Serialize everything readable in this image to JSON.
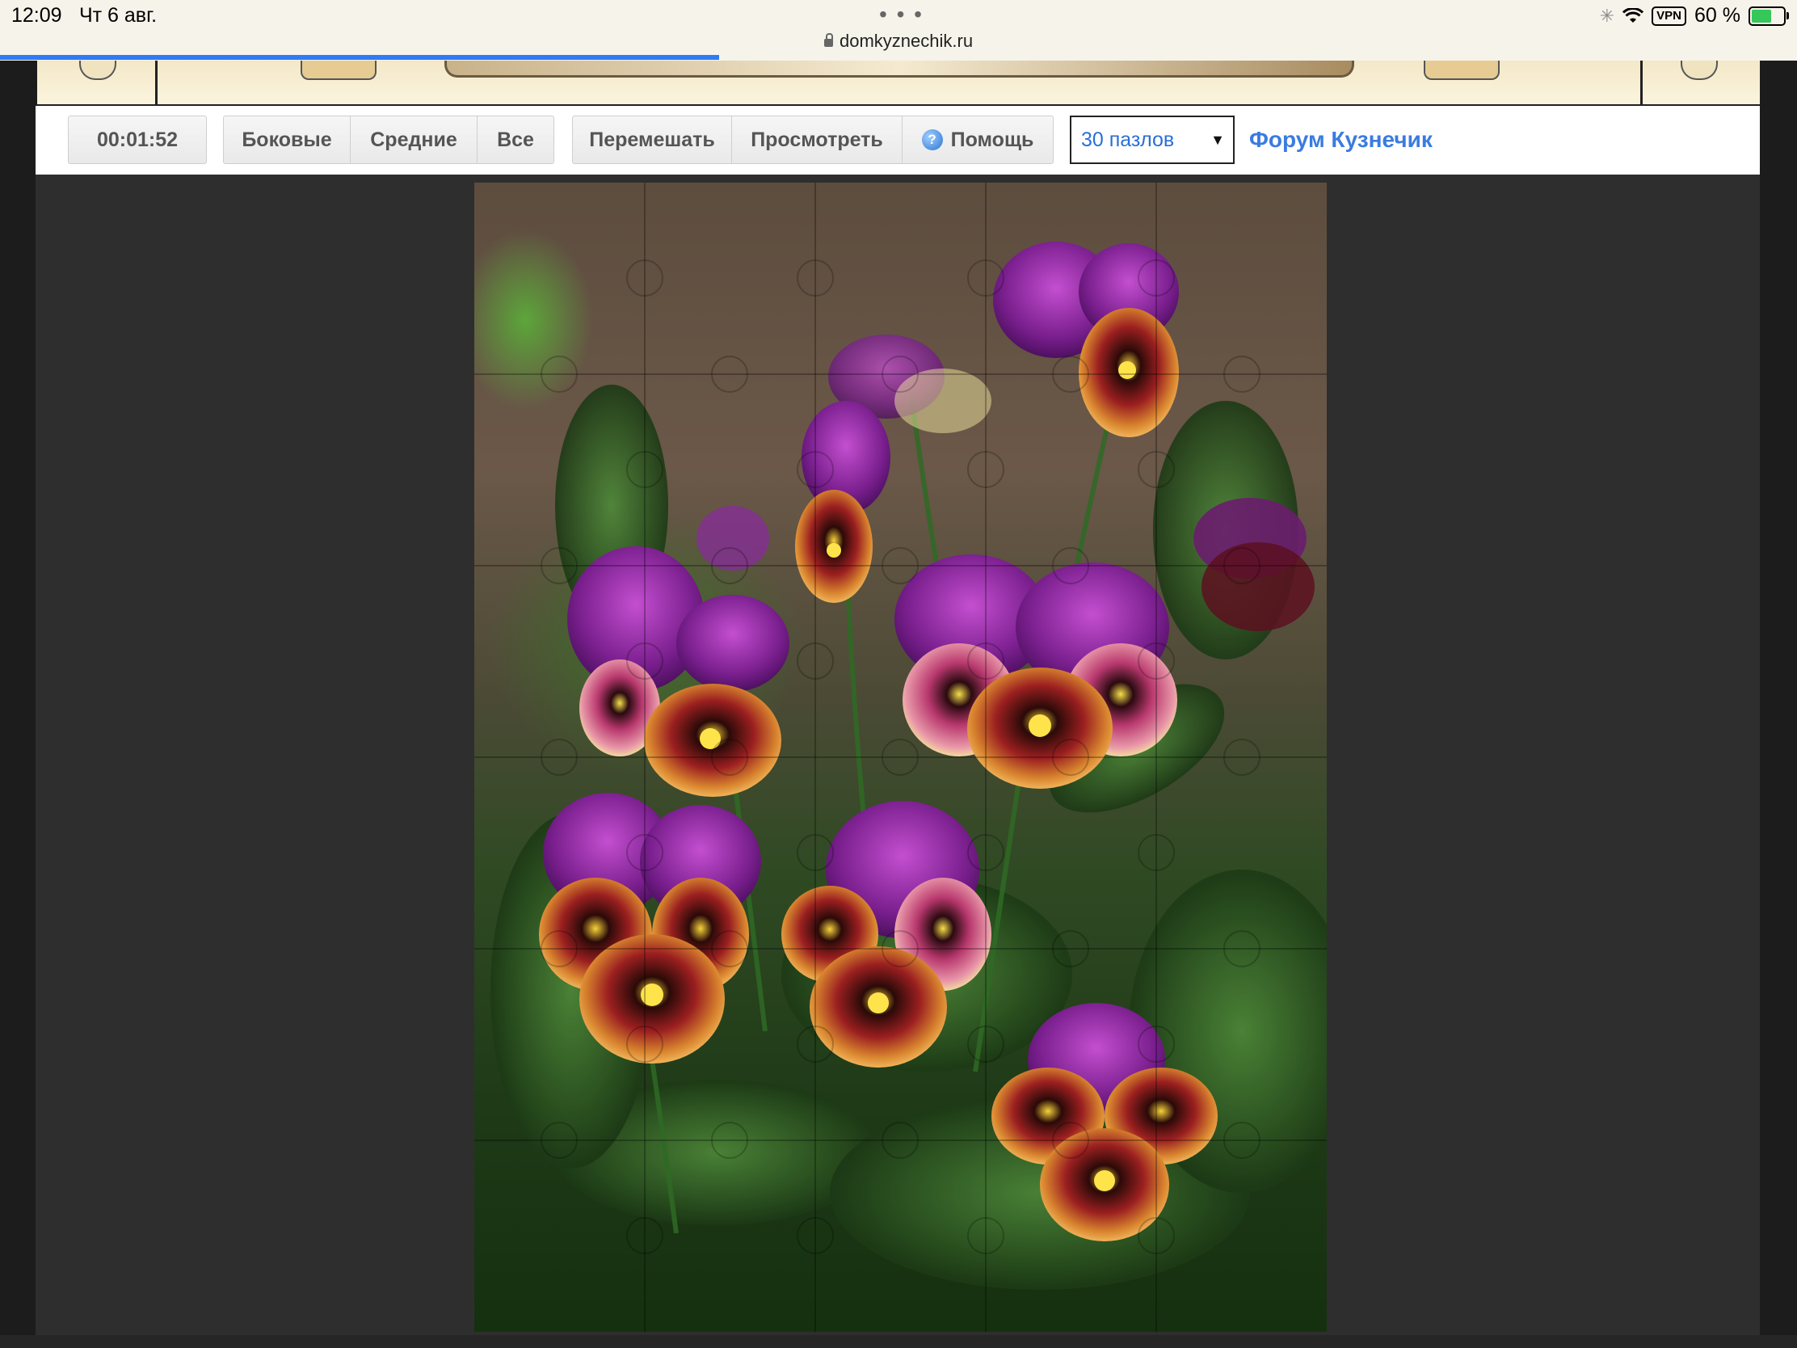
{
  "status_bar": {
    "time": "12:09",
    "date": "Чт 6 авг.",
    "url": "domkyznechik.ru",
    "vpn": "VPN",
    "battery": "60 %"
  },
  "toolbar": {
    "timer": "00:01:52",
    "filter_buttons": [
      "Боковые",
      "Средние",
      "Все"
    ],
    "action_buttons": [
      "Перемешать",
      "Просмотреть",
      "Помощь"
    ],
    "pieces_select": "30 пазлов",
    "forum_link": "Форум Кузнечик"
  },
  "puzzle": {
    "columns": 5,
    "rows": 6
  },
  "colors": {
    "accent_blue": "#3a7be0",
    "workspace": "#2e2e2e",
    "progress": "#2f7bf5"
  }
}
